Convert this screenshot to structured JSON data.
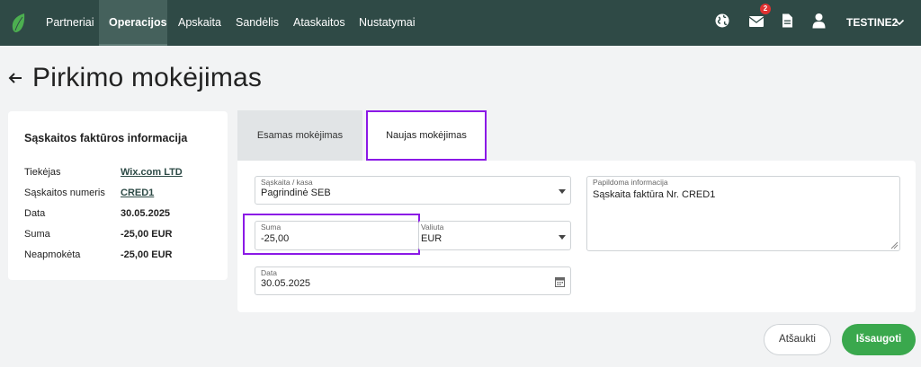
{
  "nav": {
    "items": [
      {
        "label": "Partneriai"
      },
      {
        "label": "Operacijos"
      },
      {
        "label": "Apskaita"
      },
      {
        "label": "Sandėlis"
      },
      {
        "label": "Ataskaitos"
      },
      {
        "label": "Nustatymai"
      }
    ],
    "active_item": "Operacijos",
    "mail_badge": "2",
    "user": "TESTINE2",
    "colors": {
      "bar": "#2f4a46",
      "active": "#45615c"
    }
  },
  "page": {
    "title": "Pirkimo mokėjimas"
  },
  "invoice_info": {
    "title": "Sąskaitos faktūros informacija",
    "rows": [
      {
        "label": "Tiekėjas",
        "value": "Wix.com LTD"
      },
      {
        "label": "Sąskaitos numeris",
        "value": "CRED1"
      },
      {
        "label": "Data",
        "value": "30.05.2025"
      },
      {
        "label": "Suma",
        "value": "-25,00 EUR"
      },
      {
        "label": "Neapmokėta",
        "value": "-25,00 EUR"
      }
    ]
  },
  "tabs": [
    {
      "label": "Esamas mokėjimas"
    },
    {
      "label": "Naujas mokėjimas"
    }
  ],
  "form": {
    "account": {
      "label": "Sąskaita / kasa",
      "value": "Pagrindinė SEB"
    },
    "amount": {
      "label": "Suma",
      "value": "-25,00"
    },
    "currency": {
      "label": "Valiuta",
      "value": "EUR"
    },
    "date": {
      "label": "Data",
      "value": "30.05.2025"
    },
    "notes": {
      "label": "Papildoma informacija",
      "value": "Sąskaita faktūra Nr. CRED1"
    }
  },
  "actions": {
    "cancel": "Atšaukti",
    "save": "Išsaugoti"
  },
  "accent_colors": {
    "highlight": "#8b19e6",
    "save": "#3aa84d"
  }
}
